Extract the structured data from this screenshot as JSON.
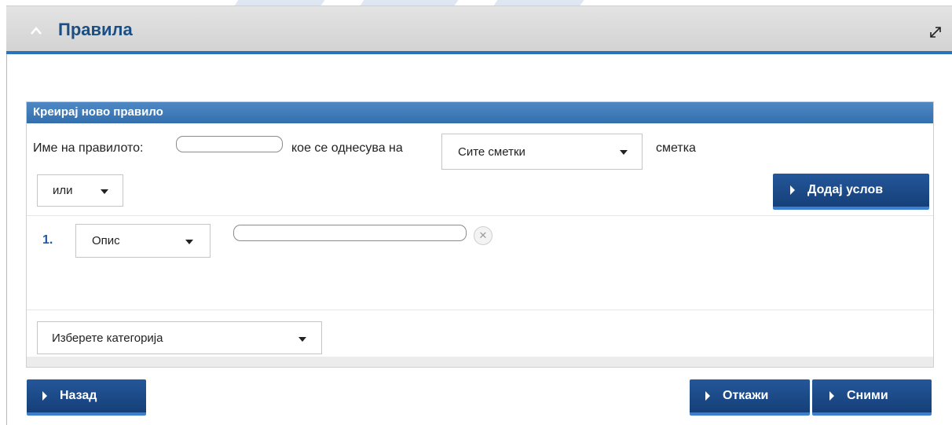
{
  "panel": {
    "title": "Правила"
  },
  "create_rule": {
    "header": "Креирај ново правило",
    "rule_name_label": "Име на правилото:",
    "rule_name_value": "",
    "applies_to_label": "кое се однесува на",
    "account_select_value": "Сите сметки",
    "account_suffix_label": "сметка",
    "logic_select_value": "или",
    "add_condition_label": "Додај услов",
    "conditions": [
      {
        "number": "1.",
        "field_select_value": "Опис",
        "value": ""
      }
    ],
    "category_select_value": "Изберете категорија"
  },
  "buttons": {
    "back": "Назад",
    "cancel": "Откажи",
    "save": "Сними"
  },
  "colors": {
    "accent": "#2b73b8",
    "button": "#1c4c8b",
    "title": "#1b4f84"
  },
  "icons": {
    "collapse": "chevron-up-icon",
    "expand": "expand-arrows-icon",
    "remove": "close-circle-icon",
    "dropdown": "caret-down-icon",
    "button": "play-triangle-icon"
  }
}
